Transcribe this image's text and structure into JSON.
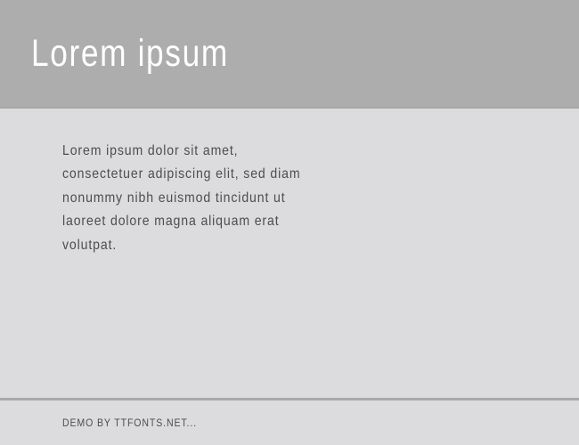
{
  "header": {
    "title": "Lorem ipsum"
  },
  "content": {
    "body_text": "Lorem ipsum dolor sit amet, consectetuer adipiscing elit, sed diam nonummy nibh euismod tincidunt ut laoreet dolore magna aliquam erat volutpat."
  },
  "footer": {
    "text": "Demo by ttfonts.net..."
  }
}
